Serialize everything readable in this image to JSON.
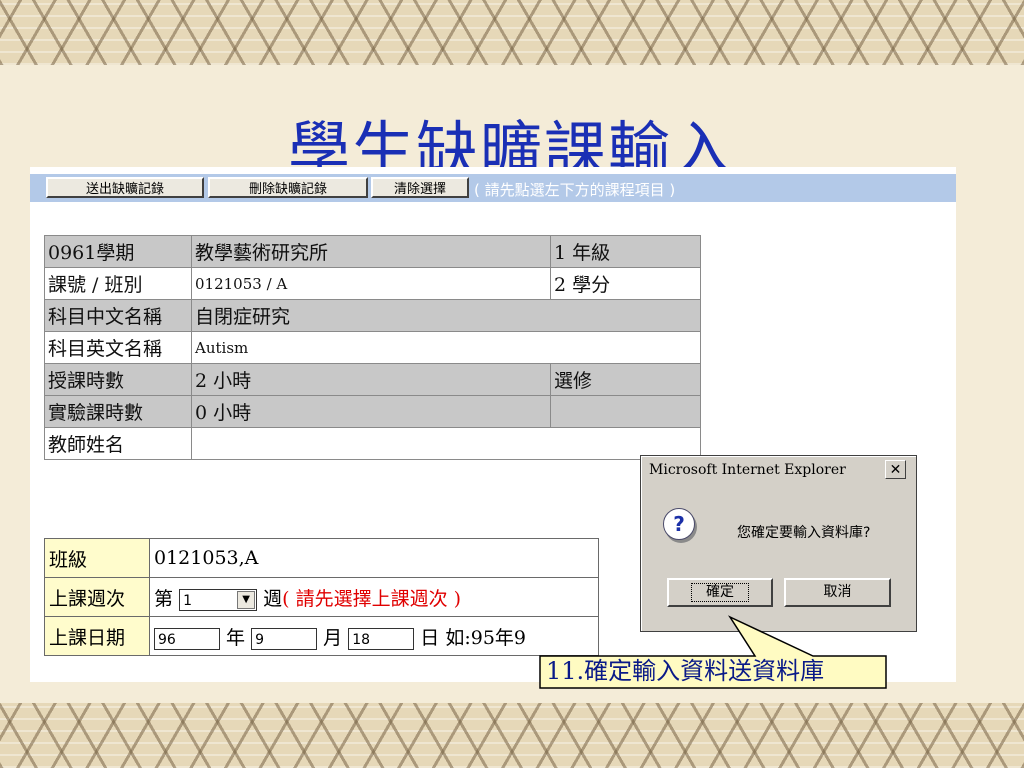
{
  "slide": {
    "title": "學生缺曠課輸入"
  },
  "toolbar": {
    "send_label": "送出缺曠記錄",
    "delete_label": "刪除缺曠記錄",
    "clear_label": "清除選擇",
    "hint": "( 請先點選左下方的課程項目 )"
  },
  "course_info": {
    "semester": "0961學期",
    "department": "教學藝術研究所",
    "grade": "1 年級",
    "course_label": "課號 / 班別",
    "course_value": "0121053 / A",
    "credits": "2 學分",
    "zh_name_label": "科目中文名稱",
    "zh_name": "自閉症研究",
    "en_name_label": "科目英文名稱",
    "en_name": "Autism",
    "hours_label": "授課時數",
    "hours": "2 小時",
    "elective": "選修",
    "lab_hours_label": "實驗課時數",
    "lab_hours": "0 小時",
    "teacher_label": "教師姓名",
    "teacher": ""
  },
  "class_form": {
    "class_label": "班級",
    "class_value": "0121053,A",
    "week_label": "上課週次",
    "week_prefix": "第",
    "week_value": "1",
    "week_suffix": "週",
    "week_hint": "( 請先選擇上課週次 )",
    "date_label": "上課日期",
    "year_value": "96",
    "year_unit": "年",
    "month_value": "9",
    "month_unit": "月",
    "day_value": "18",
    "day_unit": "日",
    "date_example": "如:95年9"
  },
  "dialog": {
    "title": "Microsoft Internet Explorer",
    "close_glyph": "✕",
    "message": "您確定要輸入資料庫?",
    "ok_label": "確定",
    "cancel_label": "取消",
    "icon": "question-icon"
  },
  "callout": {
    "text": "11.確定輸入資料送資料庫"
  },
  "colors": {
    "title": "#1a2fb5",
    "toolbar": "#b3c9e8",
    "label_bg": "#fffccc",
    "hint_red": "#e00000"
  }
}
